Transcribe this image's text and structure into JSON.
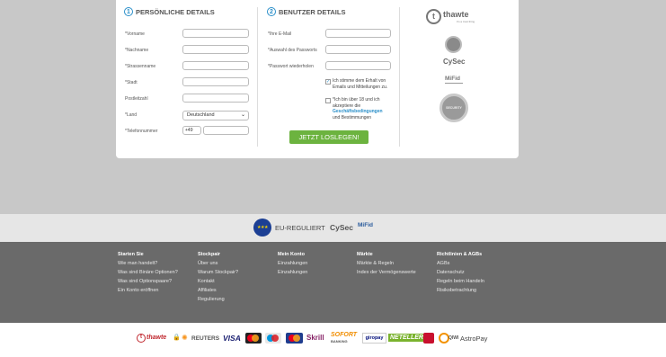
{
  "form": {
    "personal": {
      "number": "1",
      "title": "PERSÖNLICHE DETAILS",
      "fields": [
        {
          "label": "*Vorname"
        },
        {
          "label": "*Nachname"
        },
        {
          "label": "*Strassenname"
        },
        {
          "label": "*Stadt"
        },
        {
          "label": "Postleitzahl"
        },
        {
          "label": "*Land",
          "value": "Deutschland"
        },
        {
          "label": "*Telefonnummer",
          "prefix": "+49"
        }
      ]
    },
    "user": {
      "number": "2",
      "title": "BENUTZER DETAILS",
      "fields": [
        {
          "label": "*Ihre E-Mail"
        },
        {
          "label": "*Auswahl des Passworts"
        },
        {
          "label": "*Passwort wiederholen"
        }
      ],
      "consent1": "Ich stimme dem Erhalt von Emails und Mitteilungen zu.",
      "consent2_pre": "*Ich bin über 18 und ich akzeptiere die",
      "consent2_link": "Geschäftsbedingungen",
      "consent2_post": "und Bestimmungen",
      "submit": "JETZT LOSLEGEN!"
    },
    "badges": {
      "thawte": "thawte",
      "thawte_sub": "it's a trust thing",
      "cysec": "CySec",
      "mifid": "MiFid",
      "secure": "SECURITY"
    }
  },
  "regulation": {
    "text": "EU-REGULIERT",
    "cysec": "CySec",
    "mifid": "MiFid"
  },
  "footer": {
    "columns": [
      {
        "title": "Starten Sie",
        "links": [
          "Wie man handelt?",
          "Was sind Binäre Optionen?",
          "Was sind Optionspaare?",
          "Ein Konto eröffnen"
        ]
      },
      {
        "title": "Stockpair",
        "links": [
          "Über uns",
          "Warum Stockpair?",
          "Kontakt",
          "Affiliates",
          "Regulierung"
        ]
      },
      {
        "title": "Mein Konto",
        "links": [
          "Einzahlungen",
          "Einzahlungen"
        ]
      },
      {
        "title": "Märkte",
        "links": [
          "Märkte & Regeln",
          "Index der Vermögenswerte"
        ]
      },
      {
        "title": "Richtlinien & AGBs",
        "links": [
          "AGBs",
          "Datenschutz",
          "Regeln beim Handeln",
          "Risikobetrachtung"
        ]
      }
    ]
  },
  "payments": {
    "thawte": "thawte",
    "reuters": "REUTERS",
    "visa": "VISA",
    "skrill": "Skrill",
    "sofort": "SOFORT",
    "sofort_sub": "BANKING",
    "giropay": "giropay",
    "neteller": "NETELLER",
    "qiwi": "QIWI",
    "astropay": "AstroPay"
  }
}
